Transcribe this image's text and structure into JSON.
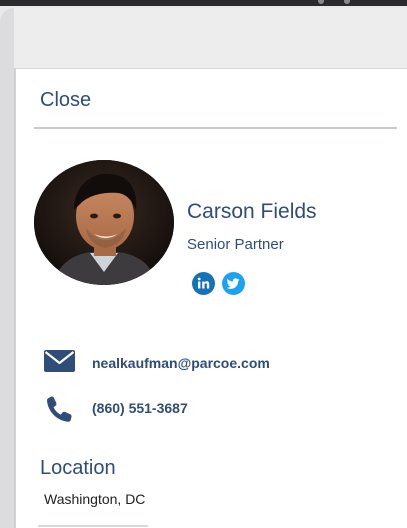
{
  "panel": {
    "close_label": "Close"
  },
  "profile": {
    "name": "Carson Fields",
    "title": "Senior Partner",
    "avatar_icon": "person-photo",
    "social": [
      {
        "name": "linkedin",
        "icon": "linkedin-icon",
        "color": "#1472b8"
      },
      {
        "name": "twitter",
        "icon": "twitter-icon",
        "color": "#1da1f2"
      }
    ]
  },
  "contact": {
    "email": "nealkaufman@parcoe.com",
    "email_icon": "envelope-icon",
    "phone": "(860) 551-3687",
    "phone_icon": "phone-icon"
  },
  "location": {
    "heading": "Location",
    "value": "Washington, DC"
  },
  "colors": {
    "accent": "#2f4d78",
    "divider": "#c5cbd2"
  }
}
